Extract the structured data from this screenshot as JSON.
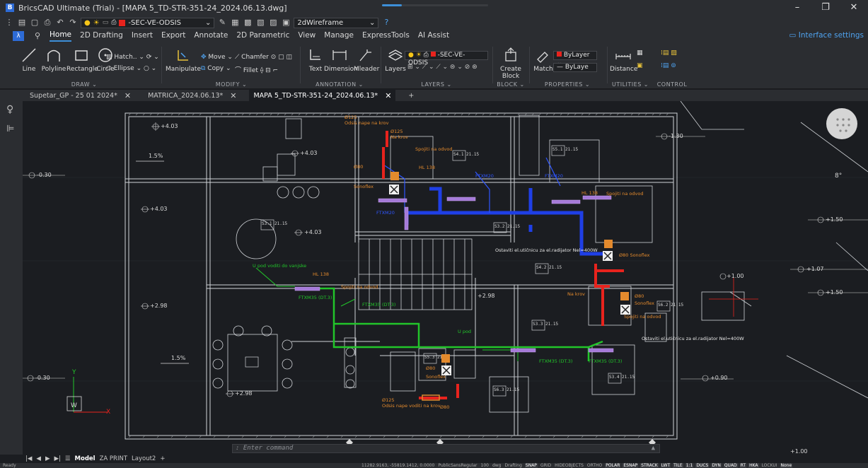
{
  "app": {
    "title": "BricsCAD Ultimate (Trial) - [MAPA 5_TD-STR-351-24_2024.06.13.dwg]",
    "logo": "B",
    "window_controls": [
      "–",
      "❐",
      "✕"
    ]
  },
  "qat": {
    "layer_name": "-SEC-VE-ODSIS",
    "visual_style": "2dWireframe"
  },
  "menu": {
    "app_button": "λ",
    "items": [
      "Home",
      "2D Drafting",
      "Insert",
      "Export",
      "Annotate",
      "2D Parametric",
      "View",
      "Manage",
      "ExpressTools",
      "AI Assist"
    ],
    "active": "Home",
    "interface_settings": "Interface settings"
  },
  "ribbon": {
    "draw": {
      "title": "DRAW",
      "line": "Line",
      "polyline": "Polyline",
      "rectangle": "Rectangle",
      "circle": "Circle",
      "hatch": "Hatch..",
      "ellipse": "Ellipse"
    },
    "modify": {
      "title": "MODIFY",
      "manipulate": "Manipulate",
      "move": "Move",
      "copy": "Copy",
      "chamfer": "Chamfer",
      "fillet": "Fillet"
    },
    "annotation": {
      "title": "ANNOTATION",
      "text": "Text",
      "dimension": "Dimension",
      "mleader": "Mleader"
    },
    "layers": {
      "title": "LAYERS",
      "layers": "Layers",
      "current_layer": "-SEC-VE-ODSIS"
    },
    "block": {
      "title": "BLOCK",
      "create_block": "Create",
      "create_block2": "Block"
    },
    "properties": {
      "title": "PROPERTIES",
      "match": "Match",
      "color": "ByLayer",
      "linetype": "ByLaye"
    },
    "utilities": {
      "title": "UTILITIES",
      "distance": "Distance"
    },
    "control": {
      "title": "CONTROL"
    }
  },
  "doc_tabs": [
    {
      "label": "Supetar_GP - 25 01 2024*",
      "active": false
    },
    {
      "label": "MATRICA_2024.06.13*",
      "active": false
    },
    {
      "label": "MAPA 5_TD-STR-351-24_2024.06.13*",
      "active": true
    }
  ],
  "doc_tabs_add": "+",
  "drawing": {
    "room_tags": [
      "S3.1 21.15",
      "S4.1 21.15",
      "S5.1 21.15",
      "S3.2 21.15",
      "S4.2 21.15",
      "S6.2 21.15",
      "S3.3 21.15",
      "S5.3 21.15",
      "S6.3 21.15",
      "S3.4 21.15"
    ],
    "levels": [
      "+4.03",
      "+4.03",
      "+4.03",
      "+4.03",
      "+2.98",
      "+2.98",
      "+2.98",
      "-0.30",
      "-0.30",
      "+1.50",
      "+1.50",
      "+1.07",
      "+1.00",
      "+0.90",
      "+1.00",
      "-1.30"
    ],
    "slopes": [
      "1.5%",
      "1.5%"
    ],
    "annotations_orange": [
      "Ø125",
      "Odsis nape na krov",
      "Ø125",
      "Na krov",
      "Spojiti na odvod",
      "Ø80",
      "Sonoflex",
      "HL 138",
      "Ø125",
      "Odsis nape voditi na krov",
      "Ø80",
      "Ø80",
      "Sonoflex",
      "Spojiti na odvod",
      "HL 138",
      "Ø80",
      "Sonoflex",
      "Spojiti na odvod",
      "HL 138",
      "Ø80 Sonoflex",
      "Na krov",
      "Spojiti na odvod"
    ],
    "annotations_white": [
      "Ostaviti el.utičnicu za el.radijator Nel=400W",
      "Ostaviti el.utičnicu za el.radijator Nel=400W"
    ],
    "annotations_green": [
      "U pod voditi do vanjske",
      "FTXM35 (DT.3)",
      "U pod",
      "FTXM35 (DT.3)",
      "FTXM35 (DT.3)",
      "FTXM35 (DT.3)"
    ],
    "annotations_blue": [
      "FTXM20",
      "FTXM20",
      "FTXM20"
    ],
    "ucs_x": "X",
    "ucs_y": "Y",
    "ucs_w": "W",
    "compass_label": "8°"
  },
  "command": {
    "prompt": ": Enter command"
  },
  "layout_tabs": [
    "Model",
    "ZA PRINT",
    "Layout2",
    "+"
  ],
  "layout_active": "Model",
  "status": {
    "ready": "Ready",
    "coords": "11282.9163, -55819.1412, 0.0000",
    "font": "PublicSansRegular",
    "scale": "100",
    "units": "dwg",
    "workspace": "Drafting",
    "toggles": [
      "SNAP",
      "GRID",
      "HIDEOBJECTS",
      "ORTHO",
      "POLAR",
      "ESNAP",
      "STRACK",
      "LWT",
      "TILE",
      "1:1",
      "DUCS",
      "DYN",
      "QUAD",
      "RT",
      "HKA",
      "LOCKUI",
      "None"
    ]
  },
  "colors": {
    "background": "#1b1d21",
    "wall": "#d8d8d8",
    "blue_pipe": "#1f3fe6",
    "green_pipe": "#22c52a",
    "red_pipe": "#e8231d",
    "orange_text": "#e38a2d",
    "accent": "#3d8fd8"
  }
}
